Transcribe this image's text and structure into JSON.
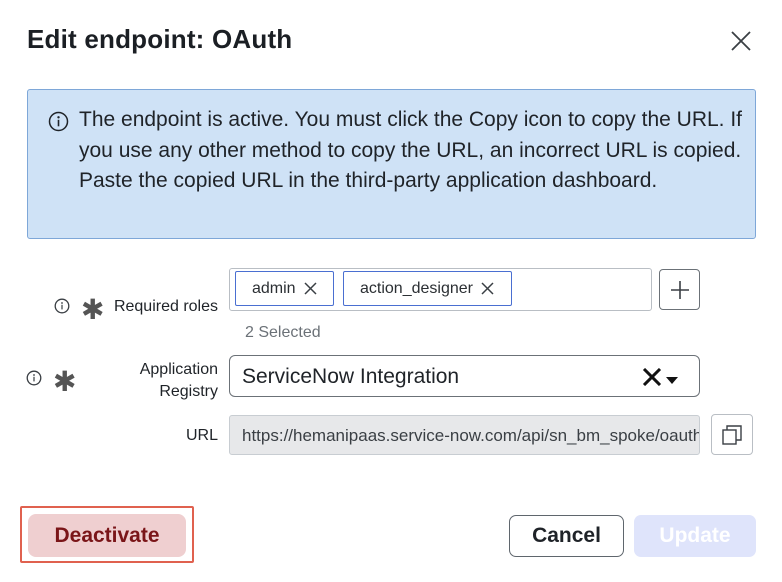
{
  "dialog": {
    "title": "Edit endpoint: OAuth",
    "close_icon": "close-icon"
  },
  "alert": {
    "icon": "info-icon",
    "text": "The endpoint is active. You must click the Copy icon to copy the URL. If you use any other method to copy the URL, an incorrect URL is copied. Paste the copied URL in the third-party application dashboard."
  },
  "roles": {
    "label": "Required roles",
    "required_marker": "✱",
    "chips": [
      {
        "label": "admin"
      },
      {
        "label": "action_designer"
      }
    ],
    "selected_count": "2 Selected",
    "add_icon": "plus-icon"
  },
  "app_registry": {
    "label_line1": "Application",
    "label_line2": "Registry",
    "required_marker": "✱",
    "value": "ServiceNow Integration"
  },
  "url": {
    "label": "URL",
    "value": "https://hemanipaas.service-now.com/api/sn_bm_spoke/oauth",
    "copy_icon": "copy-icon"
  },
  "footer": {
    "deactivate_label": "Deactivate",
    "cancel_label": "Cancel",
    "update_label": "Update"
  },
  "colors": {
    "alert_bg": "#cfe2f6",
    "chip_border": "#4a6fd1",
    "deactivate_bg": "#efcfd0",
    "deactivate_text": "#7a1518",
    "highlight_outline": "#e0614f",
    "update_disabled_bg": "#dfe4fb"
  }
}
